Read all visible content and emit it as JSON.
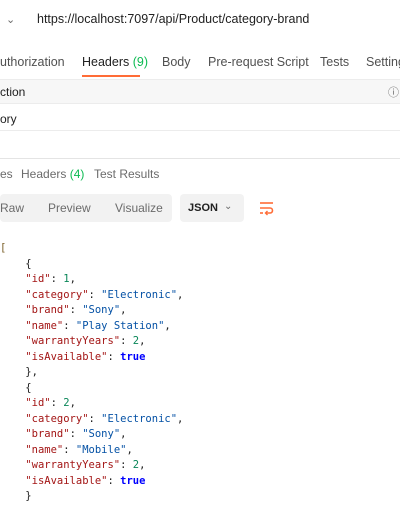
{
  "request": {
    "url": "https://localhost:7097/api/Product/category-brand"
  },
  "request_tabs": [
    {
      "label": "uthorization"
    },
    {
      "label": "Headers",
      "count": "(9)"
    },
    {
      "label": "Body"
    },
    {
      "label": "Pre-request Script"
    },
    {
      "label": "Tests"
    },
    {
      "label": "Setting"
    }
  ],
  "section": {
    "label": "ction",
    "row_value": "ory"
  },
  "response_tabs": [
    {
      "label": "es"
    },
    {
      "label": "Headers",
      "count": "(4)"
    },
    {
      "label": "Test Results"
    }
  ],
  "view_modes": {
    "raw": "Raw",
    "preview": "Preview",
    "visualize": "Visualize",
    "format": "JSON"
  },
  "response_json": [
    {
      "id": "1",
      "category": "\"Electronic\"",
      "brand": "\"Sony\"",
      "name": "\"Play Station\"",
      "warrantyYears": "2",
      "isAvailable": "true"
    },
    {
      "id": "2",
      "category": "\"Electronic\"",
      "brand": "\"Sony\"",
      "name": "\"Mobile\"",
      "warrantyYears": "2",
      "isAvailable": "true"
    }
  ],
  "json_keys": {
    "id": "\"id\"",
    "category": "\"category\"",
    "brand": "\"brand\"",
    "name": "\"name\"",
    "warrantyYears": "\"warrantyYears\"",
    "isAvailable": "\"isAvailable\""
  },
  "colors": {
    "accent": "#ff6c37",
    "count_green": "#0cbb52"
  }
}
